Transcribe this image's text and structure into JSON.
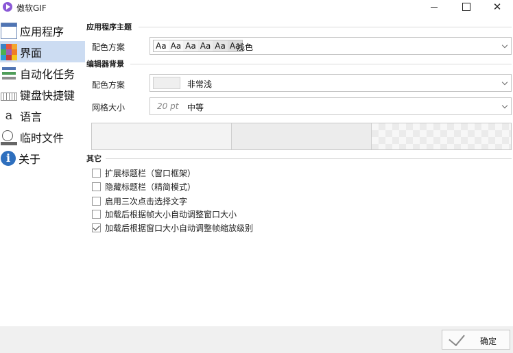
{
  "window": {
    "title": "傲软GIF"
  },
  "sidebar": {
    "items": [
      {
        "label": "应用程序",
        "icon": "app-window-icon",
        "active": false
      },
      {
        "label": "界面",
        "icon": "color-palette-icon",
        "active": true
      },
      {
        "label": "自动化任务",
        "icon": "task-list-icon",
        "active": false
      },
      {
        "label": "键盘快捷键",
        "icon": "keyboard-icon",
        "active": false
      },
      {
        "label": "语言",
        "icon": "language-icon",
        "active": false
      },
      {
        "label": "临时文件",
        "icon": "temp-files-icon",
        "active": false
      },
      {
        "label": "关于",
        "icon": "info-icon",
        "active": false
      }
    ],
    "lang_glyph": "a",
    "info_glyph": "i"
  },
  "app_theme": {
    "header": "应用程序主题",
    "scheme_label": "配色方案",
    "scheme_samples": [
      "Aa",
      "Aa",
      "Aa",
      "Aa",
      "Aa",
      "Aa"
    ],
    "scheme_value": "浅色"
  },
  "editor_background": {
    "header": "编辑器背景",
    "scheme_label": "配色方案",
    "scheme_value": "非常浅",
    "grid_label": "网格大小",
    "grid_size": "20 pt",
    "grid_value": "中等"
  },
  "other": {
    "header": "其它",
    "options": [
      {
        "label": "扩展标题栏（窗口框架）",
        "checked": false
      },
      {
        "label": "隐藏标题栏（精简模式）",
        "checked": false
      },
      {
        "label": "启用三次点击选择文字",
        "checked": false
      },
      {
        "label": "加载后根据帧大小自动调整窗口大小",
        "checked": false
      },
      {
        "label": "加载后根据窗口大小自动调整帧缩放级别",
        "checked": true
      }
    ]
  },
  "footer": {
    "ok_label": "确定"
  },
  "colors": {
    "accent": "#ccdcf2",
    "palette": [
      "#3b82c4",
      "#e6533c",
      "#f2a72e",
      "#4caf50",
      "#9c5fb8",
      "#f07d24",
      "#2e9bd6",
      "#c73c3c",
      "#f5c518"
    ]
  }
}
